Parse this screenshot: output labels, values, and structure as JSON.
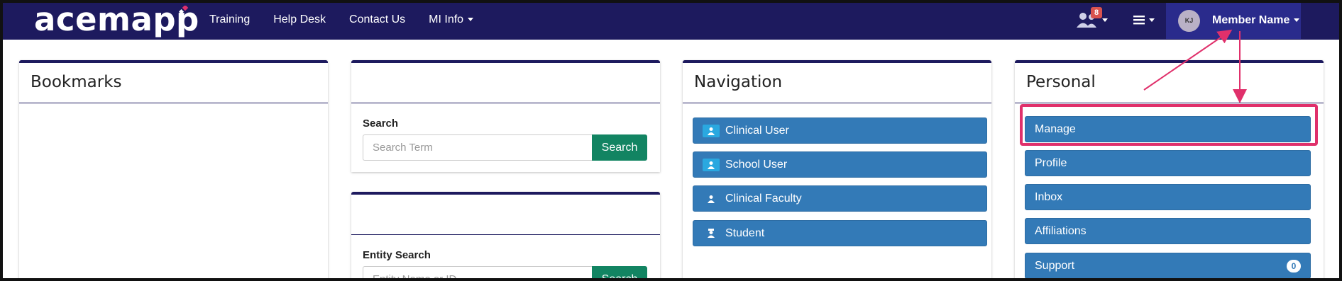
{
  "navbar": {
    "logo_text": "acemapp",
    "links": [
      {
        "label": "Training"
      },
      {
        "label": "Help Desk"
      },
      {
        "label": "Contact Us"
      },
      {
        "label": "MI Info"
      }
    ],
    "notifications_count": "8",
    "user_initials": "KJ",
    "user_name": "Member Name"
  },
  "bookmarks": {
    "title": "Bookmarks"
  },
  "search_panel": {
    "title": "",
    "field_label": "Search",
    "input_placeholder": "Search Term",
    "button_label": "Search"
  },
  "entity_panel": {
    "title": "",
    "field_label": "Entity Search",
    "input_placeholder": "Entity Name or ID",
    "button_label": "Search"
  },
  "navigation": {
    "title": "Navigation",
    "items": [
      {
        "label": "Clinical User",
        "icon": "user-icon"
      },
      {
        "label": "School User",
        "icon": "user-icon"
      },
      {
        "label": "Clinical Faculty",
        "icon": "user-icon"
      },
      {
        "label": "Student",
        "icon": "student-icon"
      }
    ]
  },
  "personal": {
    "title": "Personal",
    "items": [
      {
        "label": "Manage"
      },
      {
        "label": "Profile"
      },
      {
        "label": "Inbox"
      },
      {
        "label": "Affiliations"
      },
      {
        "label": "Support",
        "badge": "0"
      }
    ]
  },
  "colors": {
    "navbar": "#1d1a5e",
    "member_box": "#2a2b8c",
    "primary_button": "#337ab7",
    "search_button": "#128462",
    "highlight": "#e0306b"
  }
}
